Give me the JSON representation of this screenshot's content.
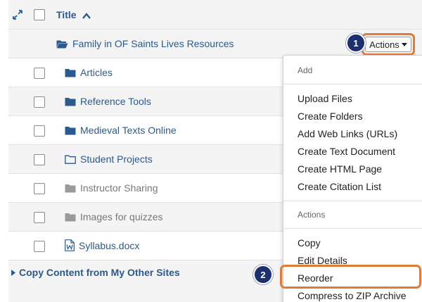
{
  "header": {
    "title_column": "Title",
    "sort_direction": "ascending"
  },
  "parent_folder": {
    "name": "Family in OF Saints Lives Resources",
    "actions_label": "Actions"
  },
  "items": [
    {
      "name": "Articles",
      "type": "folder-filled",
      "muted": false
    },
    {
      "name": "Reference Tools",
      "type": "folder-filled",
      "muted": false
    },
    {
      "name": "Medieval Texts Online",
      "type": "folder-filled",
      "muted": false
    },
    {
      "name": "Student Projects",
      "type": "folder-outline",
      "muted": false
    },
    {
      "name": "Instructor Sharing",
      "type": "folder-filled",
      "muted": true
    },
    {
      "name": "Images for quizzes",
      "type": "folder-filled",
      "muted": true
    },
    {
      "name": "Syllabus.docx",
      "type": "word-doc",
      "muted": false
    }
  ],
  "copy_content": {
    "label": "Copy Content from My Other Sites"
  },
  "menu": {
    "add_section_label": "Add",
    "add_items": [
      "Upload Files",
      "Create Folders",
      "Add Web Links (URLs)",
      "Create Text Document",
      "Create HTML Page",
      "Create Citation List"
    ],
    "actions_section_label": "Actions",
    "action_items": [
      "Copy",
      "Edit Details",
      "Reorder",
      "Compress to ZIP Archive"
    ]
  },
  "callouts": {
    "step1": "1",
    "step2": "2"
  },
  "colors": {
    "link": "#2a5a8e",
    "highlight": "#e07b39",
    "badge": "#1c2f6e",
    "muted": "#777777"
  }
}
